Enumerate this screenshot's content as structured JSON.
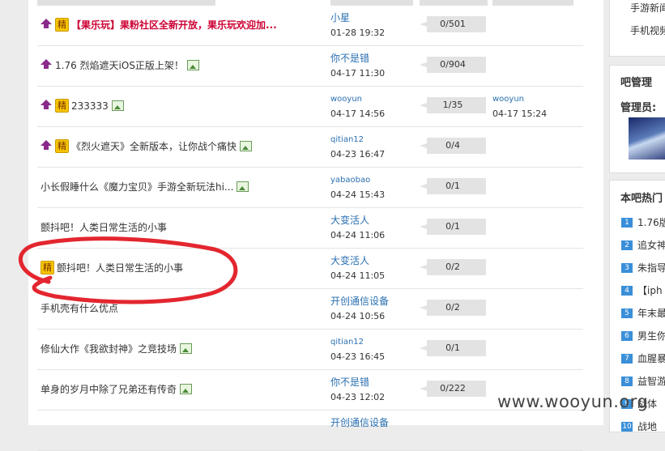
{
  "jing_label": "精",
  "rows": [
    {
      "title": "【果乐玩】果粉社区全新开放，果乐玩欢迎加...",
      "author": "小星",
      "time": "01-28 19:32",
      "replies": "0/501",
      "hot": true,
      "jing": true,
      "red": true,
      "img": false
    },
    {
      "title": "1.76 烈焰遮天iOS正版上架！",
      "author": "你不是错",
      "time": "04-17 11:30",
      "replies": "0/904",
      "hot": true,
      "jing": false,
      "img": true
    },
    {
      "title": "233333",
      "author": "wooyun",
      "time": "04-17 14:56",
      "replies": "1/35",
      "hot": true,
      "jing": true,
      "img": true,
      "last_author": "wooyun",
      "last_time": "04-17 15:24"
    },
    {
      "title": "《烈火遮天》全新版本，让你战个痛快",
      "author": "qitian12",
      "time": "04-23 16:47",
      "replies": "0/4",
      "hot": true,
      "jing": true,
      "img": true
    },
    {
      "title": "小长假睡什么《魔力宝贝》手游全新玩法hi...",
      "author": "yabaobao",
      "time": "04-24 15:43",
      "replies": "0/1",
      "img": true
    },
    {
      "title": "颤抖吧！人类日常生活的小事",
      "author": "大变活人",
      "time": "04-24 11:06",
      "replies": "0/1"
    },
    {
      "title": "颤抖吧！人类日常生活的小事",
      "author": "大变活人",
      "time": "04-24 11:05",
      "replies": "0/2",
      "jing": true
    },
    {
      "title": "手机壳有什么优点",
      "author": "开创通信设备",
      "time": "04-24 10:56",
      "replies": "0/2"
    },
    {
      "title": "修仙大作《我欲封神》之竞技场",
      "author": "qitian12",
      "time": "04-23 16:45",
      "replies": "0/1",
      "img": true
    },
    {
      "title": "单身的岁月中除了兄弟还有传奇",
      "author": "你不是错",
      "time": "04-23 12:02",
      "replies": "0/222",
      "img": true
    },
    {
      "title": "",
      "author": "开创通信设备",
      "time": "",
      "replies": ""
    }
  ],
  "sidebar": {
    "top_links": [
      "手游新闻",
      "手机视频"
    ],
    "admin_title": "吧管理",
    "admin_label": "管理员:",
    "hot_title": "本吧热门",
    "hot_items": [
      {
        "num": "1",
        "text": "1.76版"
      },
      {
        "num": "2",
        "text": "追女神"
      },
      {
        "num": "3",
        "text": "朱指导"
      },
      {
        "num": "4",
        "text": "【iph"
      },
      {
        "num": "5",
        "text": "年末最"
      },
      {
        "num": "6",
        "text": "男生你"
      },
      {
        "num": "7",
        "text": "血腥暴"
      },
      {
        "num": "8",
        "text": "益智游"
      },
      {
        "num": "9",
        "text": "战体"
      },
      {
        "num": "10",
        "text": "战地"
      }
    ]
  },
  "watermark": "www.wooyun.org"
}
